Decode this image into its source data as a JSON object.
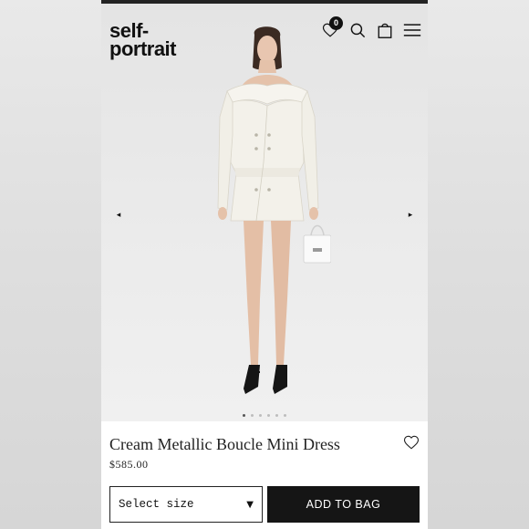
{
  "brand": {
    "logo_line1": "self-",
    "logo_line2": "portrait"
  },
  "header": {
    "wishlist_count": "0",
    "icons": [
      "heart-icon",
      "search-icon",
      "bag-icon",
      "menu-icon"
    ]
  },
  "gallery": {
    "prev_arrow": "◂",
    "next_arrow": "▸",
    "slide_count": 6,
    "active_slide": 1
  },
  "product": {
    "name": "Cream Metallic Boucle Mini Dress",
    "price": "$585.00",
    "size_placeholder": "Select size",
    "size_caret": "▼",
    "add_to_bag": "ADD TO BAG"
  },
  "colors": {
    "accent": "#151515",
    "badge": "#111111",
    "dress": "#f3f1ea"
  }
}
